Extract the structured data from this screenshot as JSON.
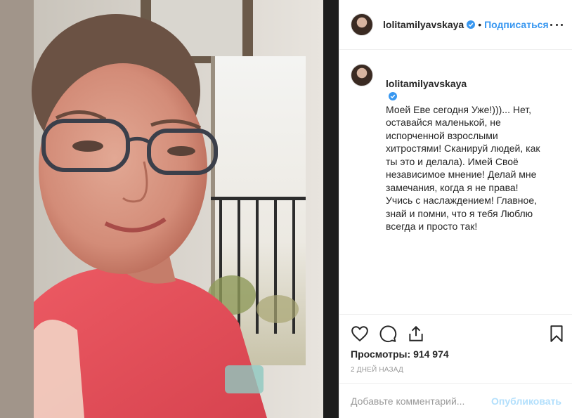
{
  "post": {
    "username": "lolitamilyavskaya",
    "follow_label": "Подписаться",
    "separator": "•",
    "caption_text": "Моей Еве сегодня Уже!)))... Нет, оставайся маленькой, не испорченной взрослыми хитростями! Сканируй людей, как ты это и делала). Имей Своё независимое мнение! Делай мне замечания, когда я не права! Учись с наслаждением! Главное, знай и помни, что я тебя Люблю всегда и просто так!",
    "views_label": "Просмотры:",
    "views_count": "914 974",
    "date": "2 ДНЕЙ НАЗАД",
    "comment_placeholder": "Добавьте комментарий...",
    "publish_label": "Опубликовать"
  },
  "icons": {
    "like": "heart-icon",
    "comment": "speech-bubble-icon",
    "share": "share-icon",
    "save": "bookmark-icon",
    "more": "ellipsis-icon",
    "verified": "verified-badge-icon"
  },
  "colors": {
    "link_blue": "#3897f0",
    "publish_disabled": "#b2dffc",
    "verified": "#3897f0",
    "muted": "#999999"
  }
}
